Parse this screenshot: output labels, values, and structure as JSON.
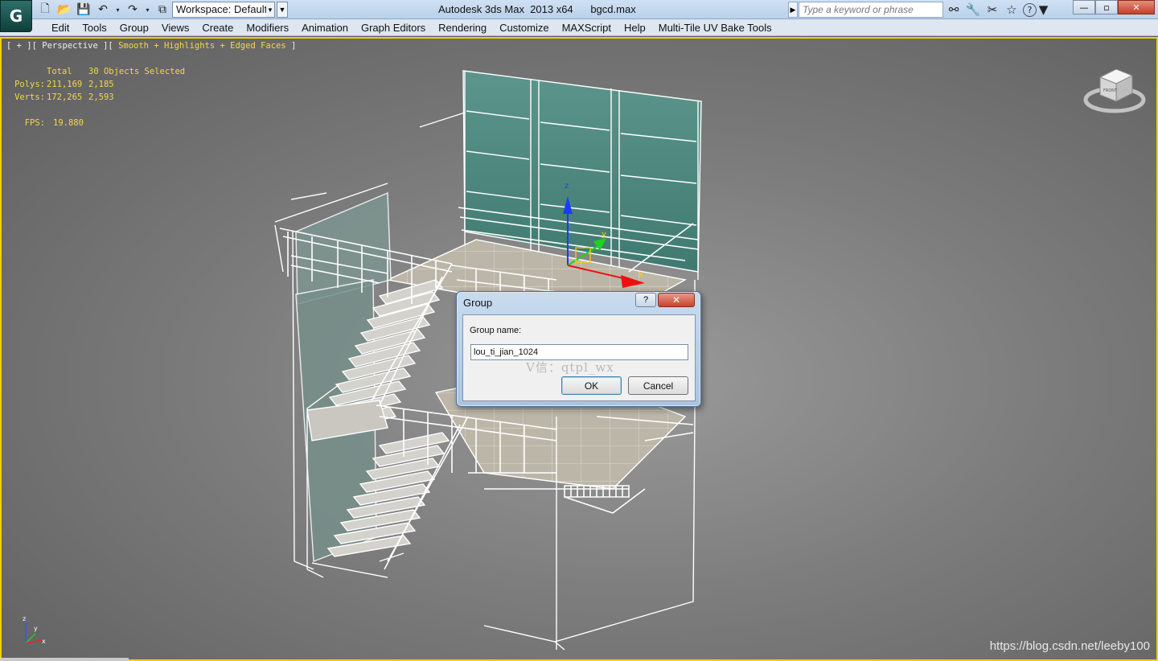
{
  "titlebar": {
    "app_title": "Autodesk 3ds Max  2013 x64      bgcd.max",
    "workspace_label": "Workspace: Default",
    "search_placeholder": "Type a keyword or phrase",
    "logo_glyph": "G"
  },
  "quick_access": [
    {
      "name": "new-file-icon",
      "glyph": "🗋"
    },
    {
      "name": "open-file-icon",
      "glyph": "📂"
    },
    {
      "name": "save-icon",
      "glyph": "💾"
    },
    {
      "name": "undo-icon",
      "glyph": "↶"
    },
    {
      "name": "undo-dropdown-icon",
      "glyph": "▾"
    },
    {
      "name": "redo-icon",
      "glyph": "↷"
    },
    {
      "name": "redo-dropdown-icon",
      "glyph": "▾"
    },
    {
      "name": "project-folder-icon",
      "glyph": "⧉"
    }
  ],
  "info_tools": [
    {
      "name": "binoculars-icon",
      "glyph": "⚯"
    },
    {
      "name": "subscription-icon",
      "glyph": "🔧"
    },
    {
      "name": "communication-icon",
      "glyph": "✂"
    },
    {
      "name": "favorites-icon",
      "glyph": "☆"
    },
    {
      "name": "help-icon",
      "glyph": "?"
    }
  ],
  "window_buttons": {
    "minimize": "—",
    "maximize": "▫",
    "close": "✕"
  },
  "menubar": {
    "items": [
      "Edit",
      "Tools",
      "Group",
      "Views",
      "Create",
      "Modifiers",
      "Animation",
      "Graph Editors",
      "Rendering",
      "Customize",
      "MAXScript",
      "Help",
      "Multi-Tile UV Bake Tools"
    ]
  },
  "viewport": {
    "label_prefix": "[ + ][ Perspective ][ ",
    "label_shading": "Smooth + Highlights + Edged Faces",
    "label_suffix": " ]",
    "stats": {
      "header_total": "Total",
      "header_selected": "30 Objects Selected",
      "polys_label": "Polys:",
      "polys_total": "211,169",
      "polys_selected": "2,185",
      "verts_label": "Verts:",
      "verts_total": "172,265",
      "verts_selected": "2,593",
      "fps_label": "FPS:",
      "fps_value": "19.880"
    },
    "viewcube_label": "FRONT",
    "axis": {
      "z": "z",
      "y": "y",
      "x": "x"
    },
    "gizmo": {
      "z": "z",
      "y": "y",
      "x": "x"
    }
  },
  "dialog": {
    "title": "Group",
    "help_label": "?",
    "close_label": "✕",
    "field_label": "Group name:",
    "field_value": "lou_ti_jian_1024",
    "overlay_text": "V信：qtpl_wx",
    "ok_label": "OK",
    "cancel_label": "Cancel"
  },
  "watermark": "https://blog.csdn.net/leeby100",
  "colors": {
    "viewport_border": "#f2d000",
    "stats_text": "#f3d84a",
    "glass": "#4f8a80",
    "wire": "#ffffff"
  }
}
